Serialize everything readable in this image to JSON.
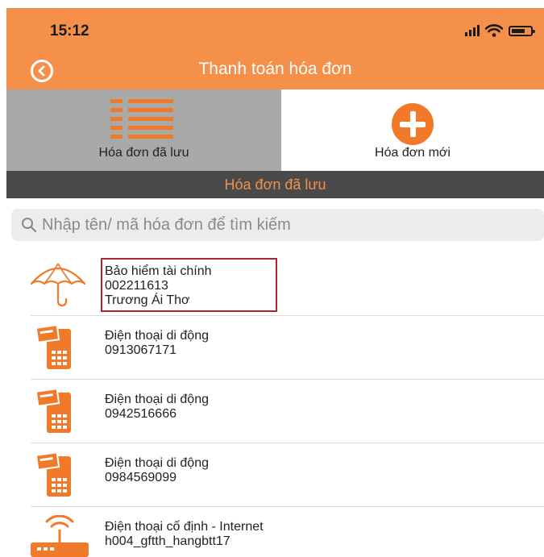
{
  "status_bar": {
    "time": "15:12"
  },
  "header": {
    "title": "Thanh toán hóa đơn",
    "back_icon": "back-circle-icon"
  },
  "tabs": [
    {
      "label": "Hóa đơn đã lưu",
      "icon": "list-icon",
      "selected": true
    },
    {
      "label": "Hóa đơn mới",
      "icon": "plus-circle-icon",
      "selected": false
    }
  ],
  "section_title": "Hóa đơn đã lưu",
  "search": {
    "placeholder": "Nhập tên/ mã hóa đơn để tìm kiếm",
    "value": ""
  },
  "bills": [
    {
      "icon": "umbrella-icon",
      "name": "Bảo hiểm tài chính",
      "code": "002211613",
      "owner": "Trương Ái Thơ"
    },
    {
      "icon": "mobile-phone-icon",
      "name": "Điện thoại di động",
      "code": "0913067171"
    },
    {
      "icon": "mobile-phone-icon",
      "name": "Điện thoại di động",
      "code": "0942516666"
    },
    {
      "icon": "mobile-phone-icon",
      "name": "Điện thoại di động",
      "code": "0984569099"
    },
    {
      "icon": "router-icon",
      "name": "Điện thoại cố định - Internet",
      "code": "h004_gftth_hangbtt17"
    }
  ],
  "colors": {
    "accent": "#f4904a",
    "icon_orange": "#f07a2a",
    "tab_selected_bg": "#a9a9a9",
    "section_bar_bg": "#4a4a4a",
    "highlight_border": "#a8272d"
  }
}
